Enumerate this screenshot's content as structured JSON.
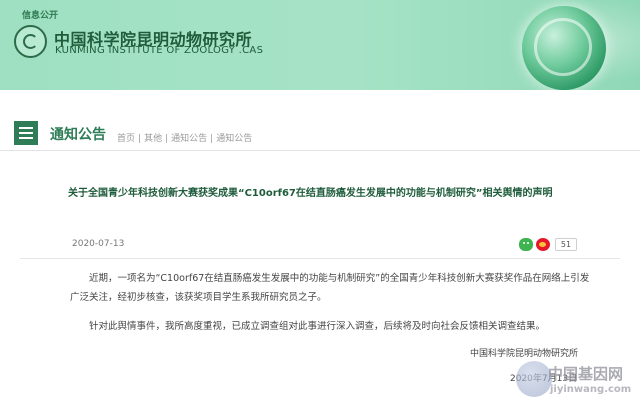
{
  "header": {
    "top_link": "信息公开",
    "logo_cn": "中国科学院昆明动物研究所",
    "logo_en": "KUNMING INSTITUTE OF ZOOLOGY .CAS"
  },
  "section": {
    "title": "通知公告",
    "breadcrumb": [
      "首页",
      "其他",
      "通知公告",
      "通知公告"
    ]
  },
  "article": {
    "title": "关于全国青少年科技创新大赛获奖成果“C10orf67在结直肠癌发生发展中的功能与机制研究”相关舆情的声明",
    "date": "2020-07-13",
    "share_count": "51",
    "paragraph1": "近期，一项名为“C10orf67在结直肠癌发生发展中的功能与机制研究”的全国青少年科技创新大赛获奖作品在网络上引发广泛关注，经初步核查，该获奖项目学生系我所研究员之子。",
    "paragraph2": "针对此舆情事件，我所高度重视，已成立调查组对此事进行深入调查，后续将及时向社会反馈相关调查结果。",
    "signature": "中国科学院昆明动物研究所",
    "signature_date": "2020年7月13日"
  },
  "watermark": {
    "cn": "中国基因网",
    "url": "jiyinwang.com"
  },
  "colors": {
    "header_bg": "#a6e3c6",
    "brand_green": "#2e7d56",
    "title_green": "#1f5c3b"
  }
}
